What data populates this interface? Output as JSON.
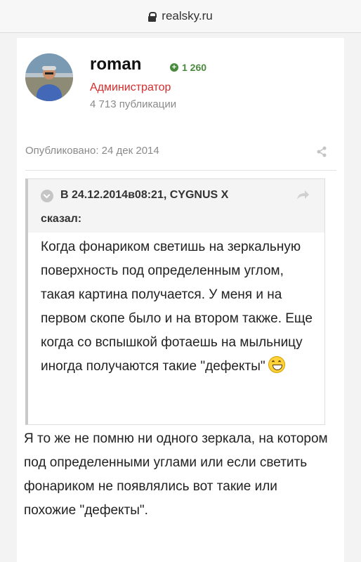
{
  "browser": {
    "url": "realsky.ru"
  },
  "post": {
    "author": {
      "name": "roman",
      "reputation": "1 260",
      "role": "Администратор",
      "posts_count": "4 713 публикации"
    },
    "published": "Опубликовано: 24 дек 2014",
    "quote": {
      "citation": "В 24.12.2014в08:21, CYGNUS X",
      "said": "сказал:",
      "text": "Когда фонариком светишь на зеркальную поверхность под определенным углом, такая картина получается. У меня и на первом скопе было и на втором также. Еще когда со вспышкой фотаешь на мыльницу иногда получаются такие \"дефекты\""
    },
    "body": "Я то же не помню ни одного зеркала, на котором под определенными углами или если светить фонариком не появлялись вот такие или похожие \"дефекты\"."
  },
  "colors": {
    "role": "#d42b2b",
    "reputation": "#4a8a3e"
  },
  "icons": [
    "lock-icon",
    "reputation-icon",
    "share-icon",
    "quote-toggle-icon",
    "reply-icon",
    "grin-emoji-icon"
  ]
}
